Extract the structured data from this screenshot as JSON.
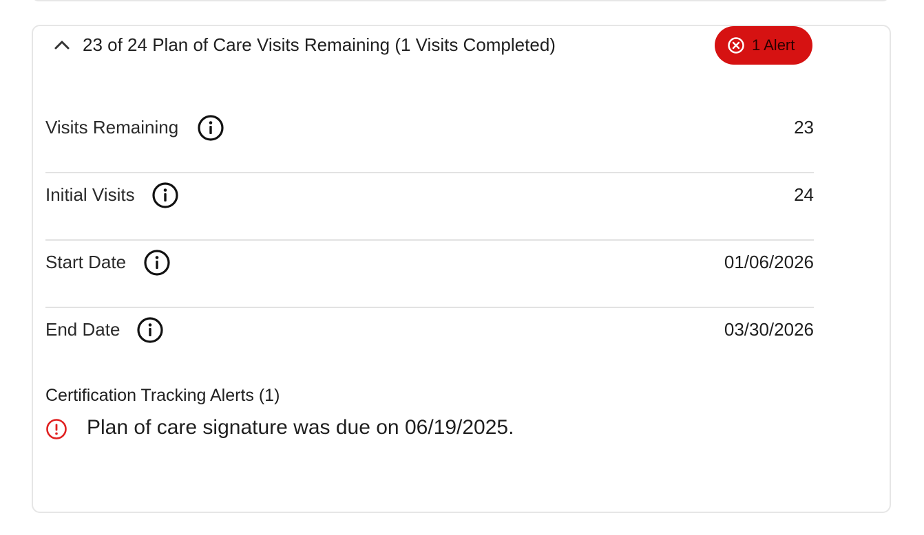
{
  "header": {
    "title": "23 of 24 Plan of Care Visits Remaining (1 Visits Completed)",
    "alert_badge_label": "1 Alert",
    "alert_badge_color": "#d61212"
  },
  "rows": [
    {
      "label": "Visits Remaining",
      "value": "23"
    },
    {
      "label": "Initial Visits",
      "value": "24"
    },
    {
      "label": "Start Date",
      "value": "01/06/2026"
    },
    {
      "label": "End Date",
      "value": "03/30/2026"
    }
  ],
  "alerts": {
    "heading": "Certification Tracking Alerts (1)",
    "items": [
      {
        "text": "Plan of care signature was due on 06/19/2025."
      }
    ],
    "icon_color": "#e02020"
  },
  "icons": {
    "collapse": "chevron-up-icon",
    "badge": "close-circle-icon",
    "info": "info-icon",
    "alert": "exclamation-circle-icon"
  }
}
